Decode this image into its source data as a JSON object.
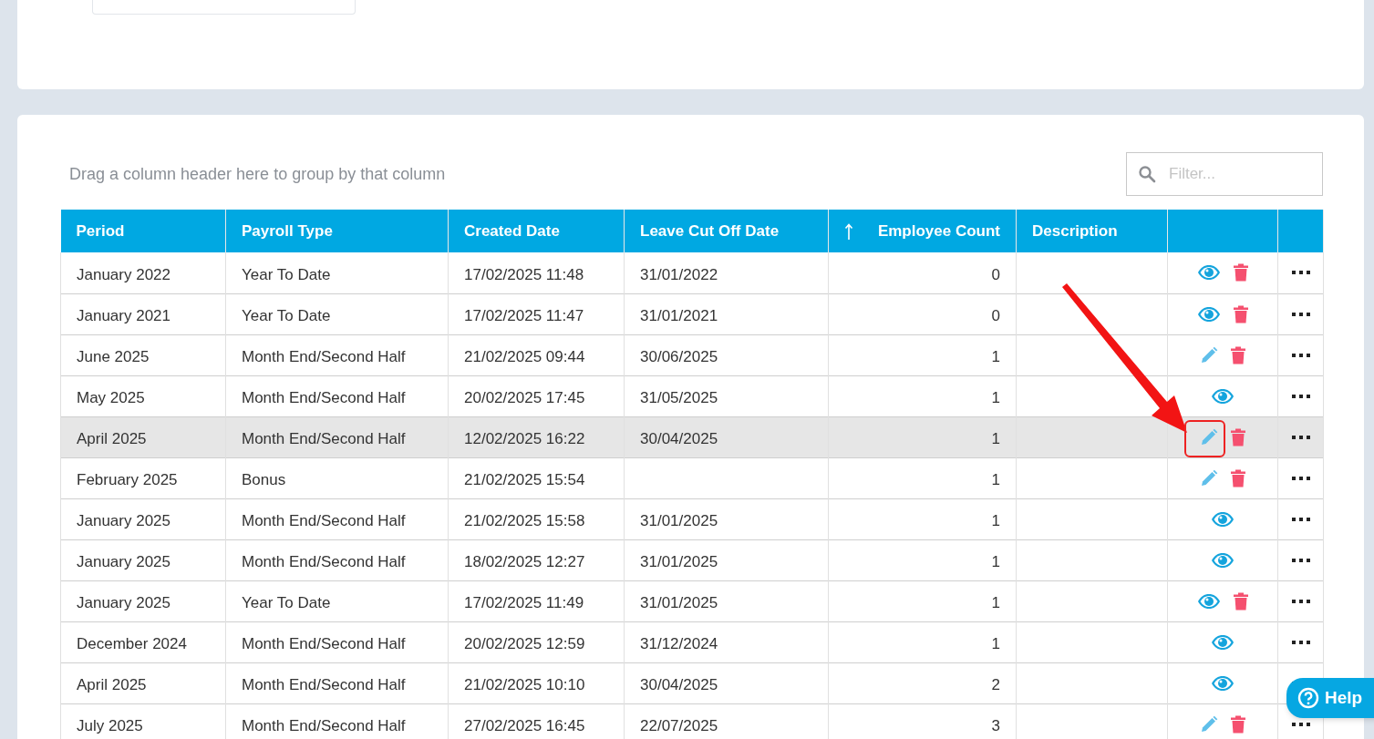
{
  "group_panel": {
    "hint": "Drag a column header here to group by that column"
  },
  "filter": {
    "placeholder": "Filter..."
  },
  "table": {
    "columns": [
      {
        "label": "Period",
        "kind": "text",
        "sorted": false
      },
      {
        "label": "Payroll Type",
        "kind": "text",
        "sorted": false
      },
      {
        "label": "Created Date",
        "kind": "text",
        "sorted": false
      },
      {
        "label": "Leave Cut Off Date",
        "kind": "text",
        "sorted": false
      },
      {
        "label": "Employee Count",
        "kind": "number",
        "sorted": true
      },
      {
        "label": "Description",
        "kind": "text",
        "sorted": false
      }
    ],
    "rows": [
      {
        "cells": [
          "January 2022",
          "Year To Date",
          "17/02/2025 11:48",
          "31/01/2022",
          "0",
          ""
        ],
        "actions": [
          {
            "kind": "view"
          },
          {
            "kind": "delete"
          }
        ],
        "selected": false
      },
      {
        "cells": [
          "January 2021",
          "Year To Date",
          "17/02/2025 11:47",
          "31/01/2021",
          "0",
          ""
        ],
        "actions": [
          {
            "kind": "view"
          },
          {
            "kind": "delete"
          }
        ],
        "selected": false
      },
      {
        "cells": [
          "June 2025",
          "Month End/Second Half",
          "21/02/2025 09:44",
          "30/06/2025",
          "1",
          ""
        ],
        "actions": [
          {
            "kind": "edit"
          },
          {
            "kind": "delete"
          }
        ],
        "selected": false
      },
      {
        "cells": [
          "May 2025",
          "Month End/Second Half",
          "20/02/2025 17:45",
          "31/05/2025",
          "1",
          ""
        ],
        "actions": [
          {
            "kind": "view"
          }
        ],
        "selected": false
      },
      {
        "cells": [
          "April 2025",
          "Month End/Second Half",
          "12/02/2025 16:22",
          "30/04/2025",
          "1",
          ""
        ],
        "actions": [
          {
            "kind": "edit"
          },
          {
            "kind": "delete"
          }
        ],
        "selected": true
      },
      {
        "cells": [
          "February 2025",
          "Bonus",
          "21/02/2025 15:54",
          "",
          "1",
          ""
        ],
        "actions": [
          {
            "kind": "edit"
          },
          {
            "kind": "delete"
          }
        ],
        "selected": false
      },
      {
        "cells": [
          "January 2025",
          "Month End/Second Half",
          "21/02/2025 15:58",
          "31/01/2025",
          "1",
          ""
        ],
        "actions": [
          {
            "kind": "view"
          }
        ],
        "selected": false
      },
      {
        "cells": [
          "January 2025",
          "Month End/Second Half",
          "18/02/2025 12:27",
          "31/01/2025",
          "1",
          ""
        ],
        "actions": [
          {
            "kind": "view"
          }
        ],
        "selected": false
      },
      {
        "cells": [
          "January 2025",
          "Year To Date",
          "17/02/2025 11:49",
          "31/01/2025",
          "1",
          ""
        ],
        "actions": [
          {
            "kind": "view"
          },
          {
            "kind": "delete"
          }
        ],
        "selected": false
      },
      {
        "cells": [
          "December 2024",
          "Month End/Second Half",
          "20/02/2025 12:59",
          "31/12/2024",
          "1",
          ""
        ],
        "actions": [
          {
            "kind": "view"
          }
        ],
        "selected": false
      },
      {
        "cells": [
          "April 2025",
          "Month End/Second Half",
          "21/02/2025 10:10",
          "30/04/2025",
          "2",
          ""
        ],
        "actions": [
          {
            "kind": "view"
          }
        ],
        "selected": false
      },
      {
        "cells": [
          "July 2025",
          "Month End/Second Half",
          "27/02/2025 16:45",
          "22/07/2025",
          "3",
          ""
        ],
        "actions": [
          {
            "kind": "edit"
          },
          {
            "kind": "delete"
          }
        ],
        "selected": false
      }
    ]
  },
  "help_button": {
    "label": "Help"
  }
}
